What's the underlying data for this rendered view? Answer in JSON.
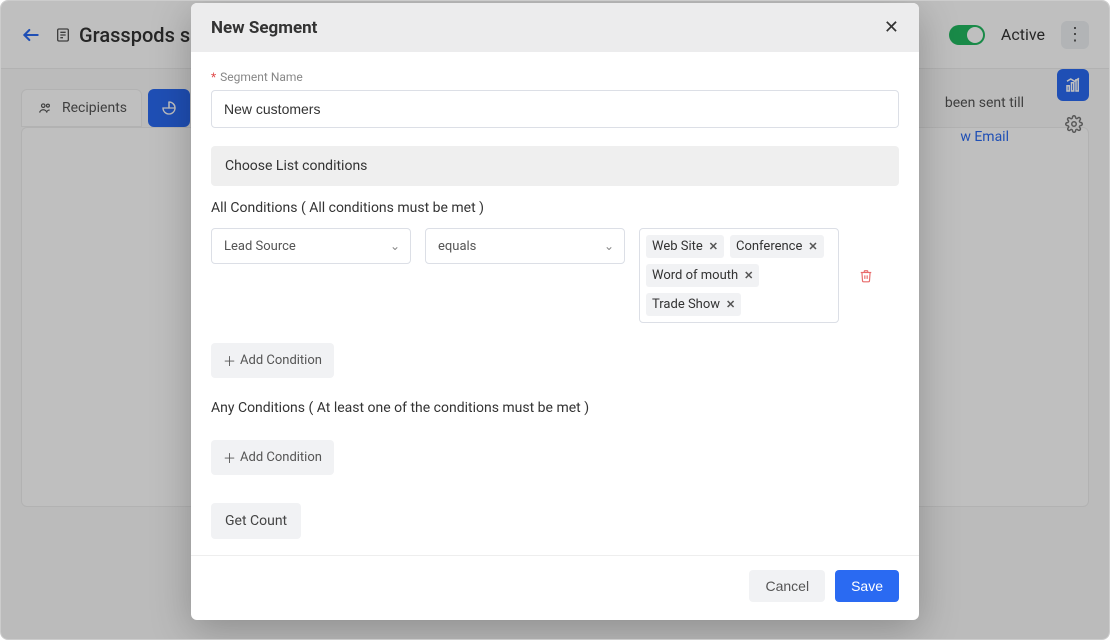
{
  "header": {
    "page_title": "Grasspods s",
    "status_label": "Active"
  },
  "tabs": {
    "recipients": "Recipients"
  },
  "side": {
    "info_text": "been sent till",
    "link_text": "w Email"
  },
  "modal": {
    "title": "New Segment",
    "segment_name_label": "Segment Name",
    "segment_name_value": "New customers",
    "choose_list_label": "Choose List conditions",
    "all_conditions_label": "All Conditions  ( All conditions must be met )",
    "any_conditions_label": "Any Conditions  ( At least one of the conditions must be met )",
    "condition_row": {
      "field": "Lead Source",
      "operator": "equals",
      "values": [
        "Web Site",
        "Conference",
        "Word of mouth",
        "Trade Show"
      ]
    },
    "add_condition_label": "Add Condition",
    "get_count_label": "Get Count",
    "cancel": "Cancel",
    "save": "Save"
  }
}
